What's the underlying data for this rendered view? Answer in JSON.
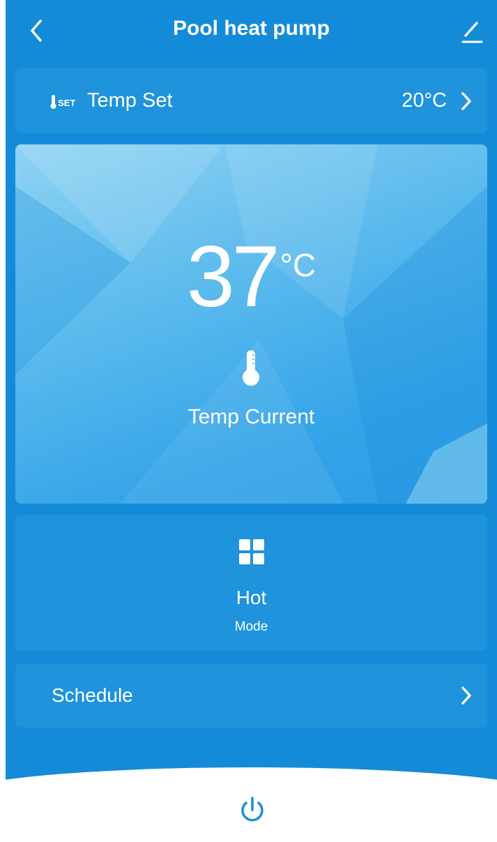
{
  "header": {
    "title": "Pool heat pump",
    "back_icon": "chevron-left-icon",
    "edit_icon": "pencil-icon"
  },
  "temp_set": {
    "icon_badge": "SET",
    "label": "Temp Set",
    "value": "20°C",
    "arrow_icon": "chevron-right-icon"
  },
  "current": {
    "value": "37",
    "unit": "°C",
    "icon": "thermometer-icon",
    "label": "Temp Current"
  },
  "mode": {
    "icon": "grid-icon",
    "value": "Hot",
    "label": "Mode"
  },
  "schedule": {
    "label": "Schedule",
    "arrow_icon": "chevron-right-icon"
  },
  "footer": {
    "power_icon": "power-icon"
  },
  "colors": {
    "primary": "#138bd8",
    "card": "#1f93dc",
    "power": "#1b8fd9",
    "text": "#ffffff"
  }
}
